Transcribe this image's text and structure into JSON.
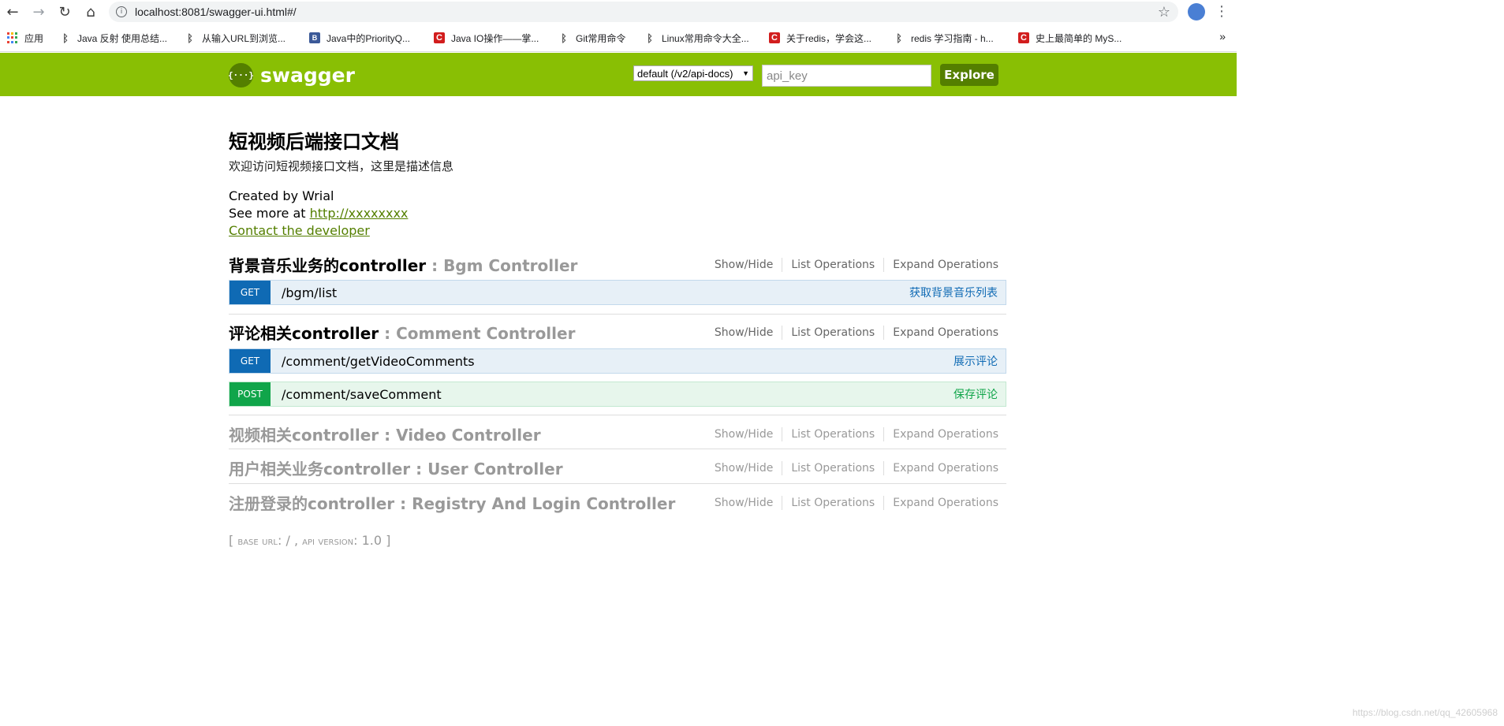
{
  "browser": {
    "url": "localhost:8081/swagger-ui.html#/",
    "bookmarks": [
      {
        "label": "应用",
        "icon": "apps-grid-icon"
      },
      {
        "label": "Java 反射 使用总结...",
        "icon": "yuque-icon"
      },
      {
        "label": "从输入URL到浏览...",
        "icon": "yuque-icon"
      },
      {
        "label": "Java中的PriorityQ...",
        "icon": "bo-icon"
      },
      {
        "label": "Java IO操作——掌...",
        "icon": "csdn-icon"
      },
      {
        "label": "Git常用命令",
        "icon": "yuque-icon"
      },
      {
        "label": "Linux常用命令大全...",
        "icon": "yuque-icon"
      },
      {
        "label": "关于redis，学会这...",
        "icon": "csdn-icon"
      },
      {
        "label": "redis 学习指南 - h...",
        "icon": "yuque-icon"
      },
      {
        "label": "史上最简单的 MyS...",
        "icon": "csdn-icon"
      }
    ],
    "more": "»"
  },
  "header": {
    "logo_text": "swagger",
    "logo_mark": "{···}",
    "spec_select": "default (/v2/api-docs)",
    "api_key_placeholder": "api_key",
    "explore_label": "Explore",
    "bar_color": "#89bf04"
  },
  "info": {
    "title": "短视频后端接口文档",
    "description": "欢迎访问短视频接口文档，这里是描述信息",
    "created_by": "Created by Wrial",
    "see_more_prefix": "See more at ",
    "see_more_link": "http://xxxxxxxx",
    "contact": "Contact the developer"
  },
  "ops_labels": {
    "show_hide": "Show/Hide",
    "list": "List Operations",
    "expand": "Expand Operations"
  },
  "resources": [
    {
      "name": "背景音乐业务的controller",
      "sub": " : Bgm Controller",
      "operations": [
        {
          "method": "GET",
          "path": "/bgm/list",
          "summary": "获取背景音乐列表"
        }
      ]
    },
    {
      "name": "评论相关controller",
      "sub": " : Comment Controller",
      "operations": [
        {
          "method": "GET",
          "path": "/comment/getVideoComments",
          "summary": "展示评论"
        },
        {
          "method": "POST",
          "path": "/comment/saveComment",
          "summary": "保存评论"
        }
      ]
    },
    {
      "name": "视频相关controller",
      "sub": " : Video Controller"
    },
    {
      "name": "用户相关业务controller",
      "sub": " : User Controller"
    },
    {
      "name": "注册登录的controller",
      "sub": " : Registry And Login Controller"
    }
  ],
  "footer": {
    "open": "[ ",
    "base_url_label": "base url",
    "base_url_value": ": / , ",
    "api_version_label": "api version",
    "api_version_value": ": 1.0 ",
    "close": "]"
  },
  "watermark": "https://blog.csdn.net/qq_42605968"
}
